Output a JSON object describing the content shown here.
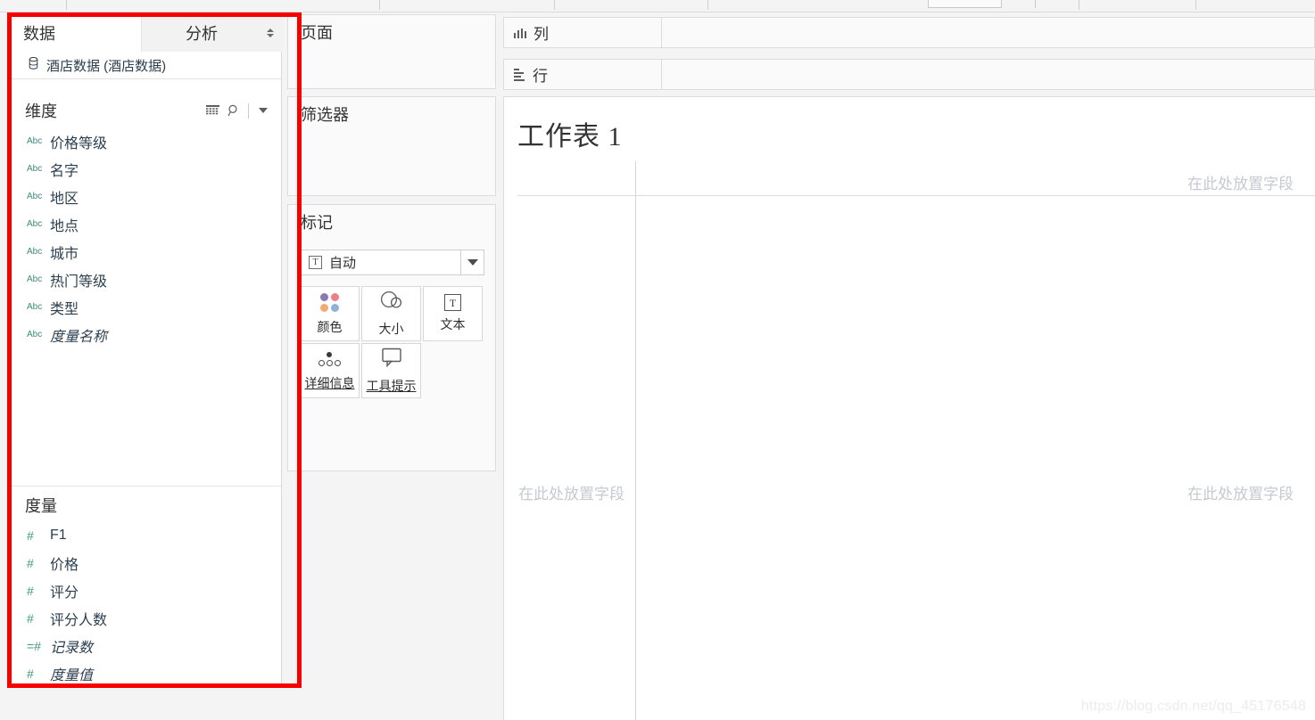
{
  "theme": {
    "accent_red": "#f60000",
    "field_blue": "#2b3f4f",
    "measure_green": "#3f9a86",
    "panel_bg": "#fafafa",
    "hint_gray": "#c6c9d1"
  },
  "data_pane": {
    "tabs": [
      {
        "label": "数据",
        "active": true
      },
      {
        "label": "分析",
        "active": false
      }
    ],
    "data_source": {
      "icon": "database-icon",
      "label": "酒店数据 (酒店数据)"
    },
    "dimensions": {
      "title": "维度",
      "tools": [
        {
          "name": "list-view-icon"
        },
        {
          "name": "search-icon"
        },
        {
          "name": "chevron-down-icon"
        }
      ],
      "fields": [
        {
          "type_icon": "Abc",
          "name": "价格等级",
          "italic": false
        },
        {
          "type_icon": "Abc",
          "name": "名字",
          "italic": false
        },
        {
          "type_icon": "Abc",
          "name": "地区",
          "italic": false
        },
        {
          "type_icon": "Abc",
          "name": "地点",
          "italic": false
        },
        {
          "type_icon": "Abc",
          "name": "城市",
          "italic": false
        },
        {
          "type_icon": "Abc",
          "name": "热门等级",
          "italic": false
        },
        {
          "type_icon": "Abc",
          "name": "类型",
          "italic": false
        },
        {
          "type_icon": "Abc",
          "name": "度量名称",
          "italic": true
        }
      ]
    },
    "measures": {
      "title": "度量",
      "fields": [
        {
          "type_icon": "#",
          "name": "F1",
          "italic": false
        },
        {
          "type_icon": "#",
          "name": "价格",
          "italic": false
        },
        {
          "type_icon": "#",
          "name": "评分",
          "italic": false
        },
        {
          "type_icon": "#",
          "name": "评分人数",
          "italic": false
        },
        {
          "type_icon": "=#",
          "name": "记录数",
          "italic": true
        },
        {
          "type_icon": "#",
          "name": "度量值",
          "italic": true
        }
      ]
    }
  },
  "cards": {
    "pages": {
      "title": "页面"
    },
    "filters": {
      "title": "筛选器"
    },
    "marks": {
      "title": "标记",
      "mark_type": {
        "icon": "text-mark-icon",
        "icon_glyph": "T",
        "value": "自动",
        "caret": "chevron-down-icon"
      },
      "buttons": [
        {
          "icon": "color-palette-icon",
          "label": "颜色",
          "underline": false
        },
        {
          "icon": "size-shapes-icon",
          "label": "大小",
          "underline": false
        },
        {
          "icon": "text-box-icon",
          "label": "文本",
          "underline": false
        },
        {
          "icon": "detail-dots-icon",
          "label": "详细信息",
          "underline": true
        },
        {
          "icon": "tooltip-bubble-icon",
          "label": "工具提示",
          "underline": true
        }
      ]
    }
  },
  "shelves": {
    "columns": {
      "icon": "columns-icon",
      "label": "列"
    },
    "rows": {
      "icon": "rows-icon",
      "label": "行"
    }
  },
  "worksheet": {
    "title": "工作表 1",
    "drop_hints": {
      "top_right": "在此处放置字段",
      "left": "在此处放置字段",
      "bottom_right": "在此处放置字段"
    }
  },
  "watermark": "https://blog.csdn.net/qq_45176548"
}
